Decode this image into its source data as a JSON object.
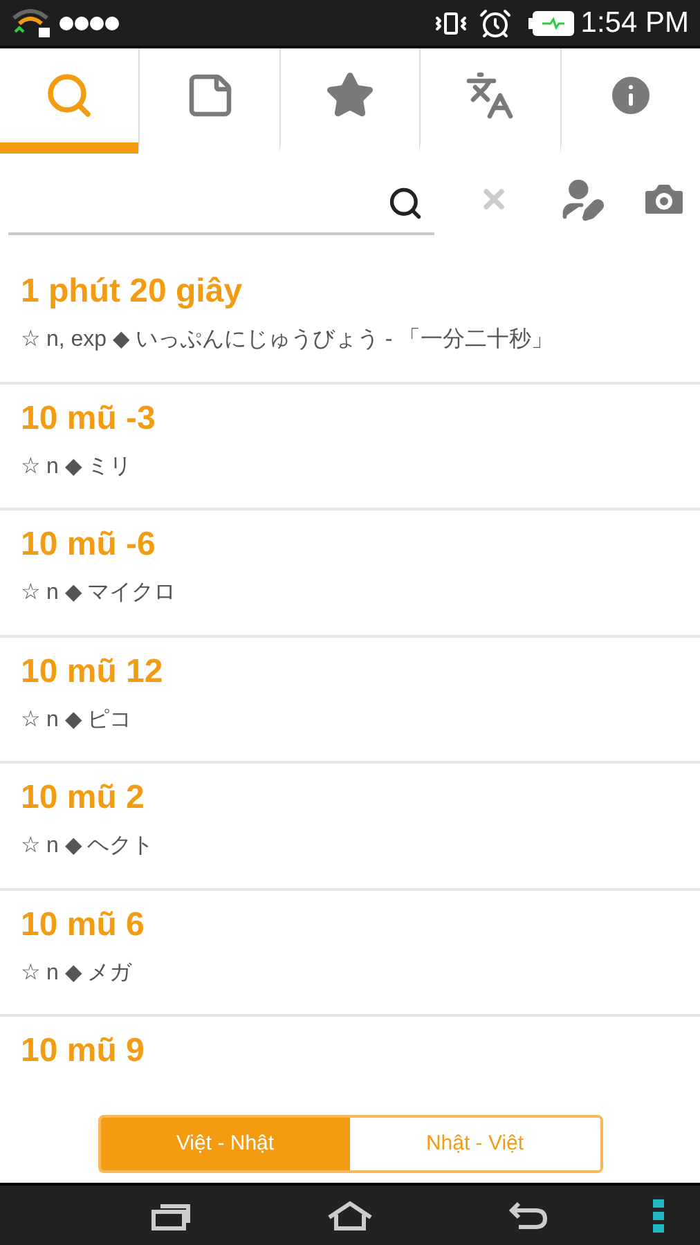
{
  "status_bar": {
    "time": "1:54 PM"
  },
  "tabs": [
    {
      "kind": "search",
      "selected": true
    },
    {
      "kind": "notes",
      "selected": false
    },
    {
      "kind": "favorites",
      "selected": false
    },
    {
      "kind": "translate",
      "selected": false
    },
    {
      "kind": "info",
      "selected": false
    }
  ],
  "entries": [
    {
      "word": "1 phút 20 giây",
      "detail": "☆ n, exp ◆ いっぷんにじゅうびょう - 「一分二十秒」"
    },
    {
      "word": "10 mũ -3",
      "detail": "☆ n ◆ ミリ"
    },
    {
      "word": "10 mũ -6",
      "detail": "☆ n ◆ マイクロ"
    },
    {
      "word": "10 mũ 12",
      "detail": "☆ n ◆ ピコ"
    },
    {
      "word": "10 mũ 2",
      "detail": "☆ n ◆ ヘクト"
    },
    {
      "word": "10 mũ 6",
      "detail": "☆ n ◆ メガ"
    },
    {
      "word": "10 mũ 9"
    }
  ],
  "direction": [
    {
      "label": "Việt - Nhật",
      "selected": true
    },
    {
      "label": "Nhật - Việt",
      "selected": false
    }
  ]
}
